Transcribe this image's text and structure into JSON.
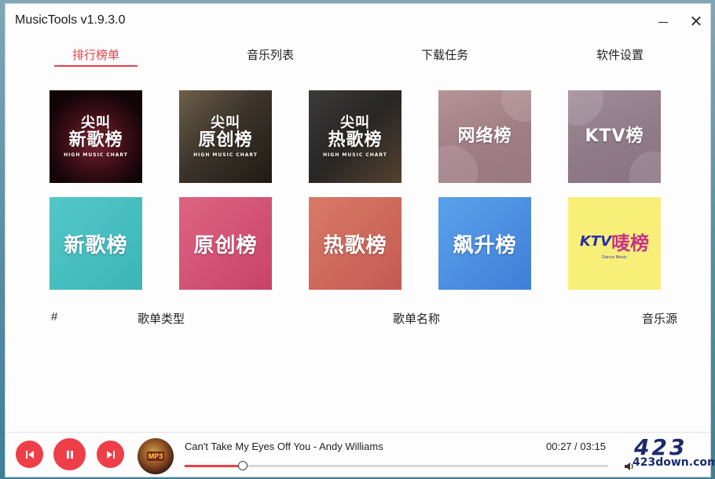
{
  "window": {
    "title": "MusicTools v1.9.3.0",
    "minimize_glyph": "",
    "close_glyph": "✕"
  },
  "tabs": [
    {
      "label": "排行榜单",
      "active": true
    },
    {
      "label": "音乐列表",
      "active": false
    },
    {
      "label": "下载任务",
      "active": false
    },
    {
      "label": "软件设置",
      "active": false
    }
  ],
  "charts": [
    {
      "line1": "尖叫",
      "line2": "新歌榜",
      "sub": "HIGH MUSIC CHART"
    },
    {
      "line1": "尖叫",
      "line2": "原创榜",
      "sub": "HIGH MUSIC CHART"
    },
    {
      "line1": "尖叫",
      "line2": "热歌榜",
      "sub": "HIGH MUSIC CHART"
    },
    {
      "line1": "网络榜"
    },
    {
      "line1": "KTV榜"
    },
    {
      "line1": "新歌榜"
    },
    {
      "line1": "原创榜"
    },
    {
      "line1": "热歌榜"
    },
    {
      "line1": "飙升榜"
    },
    {
      "logo": "KTV",
      "line1": "唛榜",
      "sub": "Dance Music"
    }
  ],
  "table": {
    "columns": [
      "#",
      "歌单类型",
      "歌单名称",
      "音乐源"
    ]
  },
  "player": {
    "track": "Can't Take My Eyes Off You - Andy Williams",
    "current_time": "00:27",
    "total_time": "03:15",
    "time_separator": " / ",
    "progress": 0.138,
    "cover_tag": "MP3"
  },
  "watermark": {
    "big": "423",
    "small": "423down.com"
  },
  "colors": {
    "accent": "#ee3e48",
    "tab_active": "#e9414b"
  },
  "icons": {
    "prev": "skip-previous-icon",
    "pause": "pause-icon",
    "next": "skip-next-icon",
    "volume": "volume-icon"
  }
}
